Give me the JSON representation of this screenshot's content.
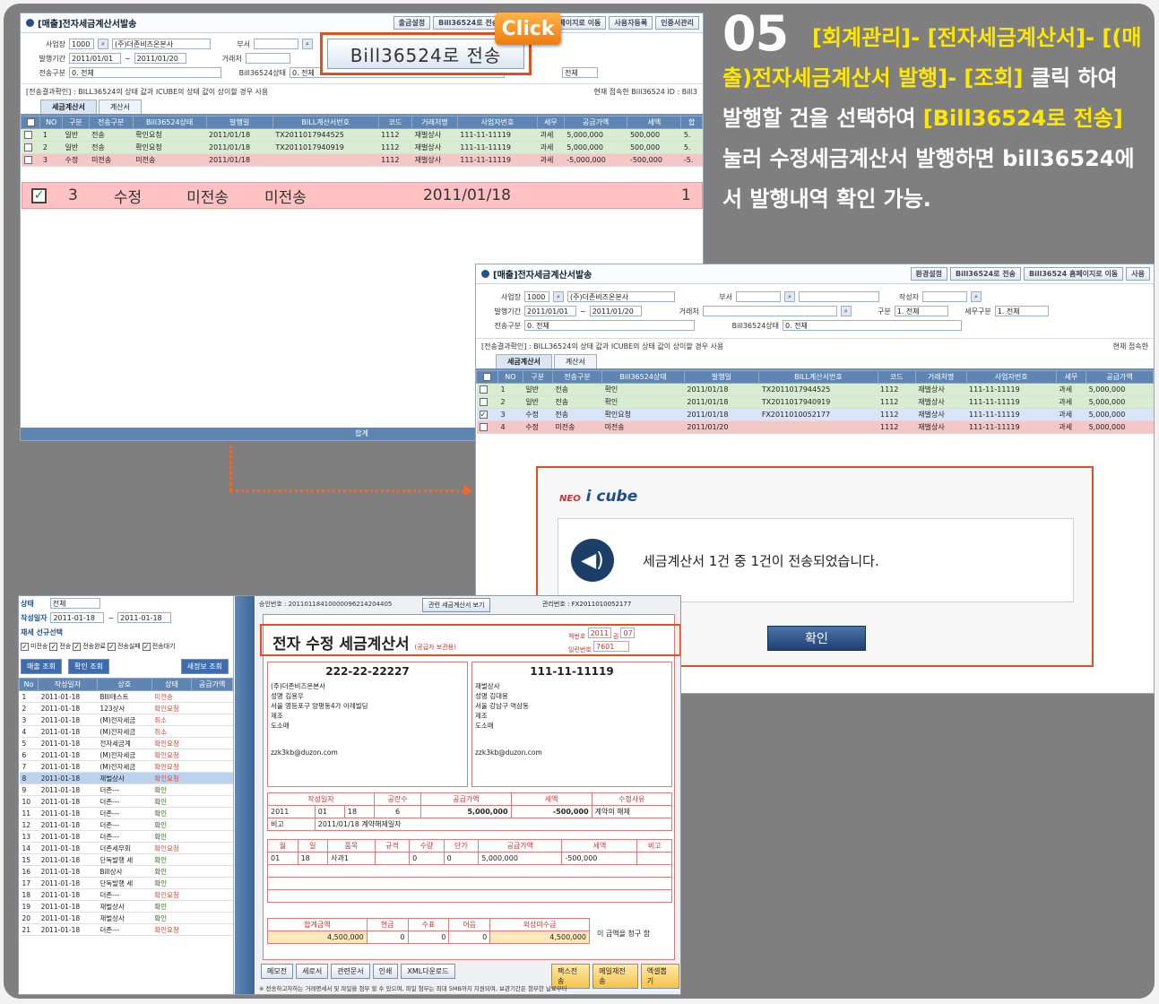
{
  "instruction": {
    "step": "05",
    "path": "[회계관리]- [전자세금계산서]- [(매출)전자세금계산서 발행]- [조회]",
    "middle": " 클릭 하여 발행할 건을 선택하여 ",
    "button_ref": "[Bill36524로 전송]",
    "tail": " 눌러 수정세금계산서 발행하면 bill36524에서 발행내역 확인 가능."
  },
  "callout": {
    "click": "Click",
    "send_button": "Bill36524로 전송"
  },
  "win1": {
    "title": "[매출]전자세금계산서발송",
    "buttons": [
      "출금설정",
      "Bill36524로 전송",
      "Bill36524 홈페이지로 이동",
      "사용자등록",
      "인증서관리"
    ],
    "form": {
      "biz_label": "사업장",
      "biz_code": "1000",
      "biz_name": "(주)더존비즈온본사",
      "dept_label": "부서",
      "period_label": "발행기간",
      "period_from": "2011/01/01",
      "period_to": "2011/01/20",
      "trade_label": "거래처",
      "send_label": "전송구분",
      "send_value": "0. 전체",
      "bill_label": "Bill36524상태",
      "bill_value": "0. 전체",
      "all": "전체"
    },
    "note": "[전송결과확인] : BILL36524의 상태 값과 ICUBE의 상태 값이 상이할 경우 사용",
    "note_right": "현재 접속한 Bill36524 ID : Bill3",
    "tabs": [
      "세금계산서",
      "계산서"
    ],
    "headers": [
      "",
      "NO",
      "구분",
      "전송구분",
      "Bill36524상태",
      "발행일",
      "BILL계산서번호",
      "코드",
      "거래처명",
      "사업자번호",
      "세무",
      "공급가액",
      "세액",
      "합"
    ],
    "rows": [
      [
        "",
        "1",
        "일반",
        "전송",
        "확인요청",
        "2011/01/18",
        "TX2011017944525",
        "1112",
        "재벌상사",
        "111-11-11119",
        "과세",
        "5,000,000",
        "500,000",
        "5."
      ],
      [
        "",
        "2",
        "일반",
        "전송",
        "확인요청",
        "2011/01/18",
        "TX2011017940919",
        "1112",
        "재벌상사",
        "111-11-11119",
        "과세",
        "5,000,000",
        "500,000",
        "5."
      ],
      [
        "",
        "3",
        "수정",
        "미전송",
        "미전송",
        "2011/01/18",
        "",
        "1112",
        "재벌상사",
        "111-11-11119",
        "과세",
        "-5,000,000",
        "-500,000",
        "-5."
      ]
    ],
    "big": {
      "no": "3",
      "type": "수정",
      "send": "미전송",
      "bill": "미전송",
      "date": "2011/01/18",
      "tail": "1"
    },
    "footer": "합계"
  },
  "win2": {
    "title": "[매출]전자세금계산서발송",
    "buttons": [
      "환경설정",
      "Bill36524로 전송",
      "Bill36524 홈페이지로 이동",
      "사용"
    ],
    "form": {
      "biz_label": "사업장",
      "biz_code": "1000",
      "biz_name": "(주)더존비즈온본사",
      "dept_label": "부서",
      "author_label": "작성자",
      "period_label": "발행기간",
      "period_from": "2011/01/01",
      "period_to": "2011/01/20",
      "trade_label": "거래처",
      "kind_label": "구분",
      "kind_value": "1. 전체",
      "tax_label": "세무구분",
      "tax_value": "1. 전체",
      "send_label": "전송구분",
      "send_value": "0. 전체",
      "bill_label": "Bill36524상태",
      "bill_value": "0. 전체"
    },
    "note": "[전송결과확인] : BILL36524의 상태 값과 ICUBE의 상태 값이 상이할 경우 사용",
    "note_right": "현재 접속한",
    "tabs": [
      "세금계산서",
      "계산서"
    ],
    "headers": [
      "",
      "NO",
      "구분",
      "전송구분",
      "Bill36524상태",
      "발행일",
      "BILL계산서번호",
      "코드",
      "거래처명",
      "사업자번호",
      "세무",
      "공급가액"
    ],
    "rows": [
      [
        "",
        "1",
        "일반",
        "전송",
        "확인",
        "2011/01/18",
        "TX2011017944525",
        "1112",
        "재벌상사",
        "111-11-11119",
        "과세",
        "5,000,000"
      ],
      [
        "",
        "2",
        "일반",
        "전송",
        "확인",
        "2011/01/18",
        "TX2011017940919",
        "1112",
        "재벌상사",
        "111-11-11119",
        "과세",
        "5,000,000"
      ],
      [
        "v",
        "3",
        "수정",
        "전송",
        "확인요청",
        "2011/01/18",
        "FX2011010052177",
        "1112",
        "재벌상사",
        "111-11-11119",
        "과세",
        "5,000,000"
      ],
      [
        "",
        "4",
        "수정",
        "미전송",
        "미전송",
        "2011/01/20",
        "",
        "1112",
        "재벌상사",
        "111-11-11119",
        "과세",
        "5,000,000"
      ]
    ]
  },
  "dialog": {
    "brand_a": "NEO",
    "brand_b": "i cube",
    "message": "세금계산서 1건 중 1건이 전송되었습니다.",
    "ok": "확인"
  },
  "win3": {
    "side_filter": {
      "status_label": "상태",
      "status_value": "전체",
      "date_label": "작성일자",
      "date_from": "2011-01-18",
      "date_to": "2011-01-18",
      "check_label": "재세 선규선택",
      "checks": [
        "미전송",
        "전송",
        "전송완료",
        "전송실패",
        "전송대기"
      ],
      "btn_a": "매출 조회",
      "btn_b": "확인 조회",
      "btn_c": "새정보 조회"
    },
    "side_headers": [
      "No",
      "작성일자",
      "상호",
      "상태",
      "공급가액"
    ],
    "side_rows": [
      [
        "1",
        "2011-01-18",
        "BIll테스트",
        "미전송"
      ],
      [
        "2",
        "2011-01-18",
        "123상사",
        "확인요청"
      ],
      [
        "3",
        "2011-01-18",
        "(M)전자세금",
        "취소"
      ],
      [
        "4",
        "2011-01-18",
        "(M)전자세금",
        "취소"
      ],
      [
        "5",
        "2011-01-18",
        "전자세금계",
        "확인요청"
      ],
      [
        "6",
        "2011-01-18",
        "(M)전자세금",
        "확인요청"
      ],
      [
        "7",
        "2011-01-18",
        "(M)전자세금",
        "확인요청"
      ],
      [
        "8",
        "2011-01-18",
        "재벌상사",
        "확인요청"
      ],
      [
        "9",
        "2011-01-18",
        "더존---",
        "확인"
      ],
      [
        "10",
        "2011-01-18",
        "더존---",
        "확인"
      ],
      [
        "11",
        "2011-01-18",
        "더존---",
        "확인"
      ],
      [
        "12",
        "2011-01-18",
        "더존---",
        "확인"
      ],
      [
        "13",
        "2011-01-18",
        "더존---",
        "확인"
      ],
      [
        "14",
        "2011-01-18",
        "더존세무회",
        "확인요청"
      ],
      [
        "15",
        "2011-01-18",
        "단독발행 세",
        "확인"
      ],
      [
        "16",
        "2011-01-18",
        "Bill상사",
        "확인"
      ],
      [
        "17",
        "2011-01-18",
        "단독발행 세",
        "확인"
      ],
      [
        "18",
        "2011-01-18",
        "더존---",
        "확인요청"
      ],
      [
        "19",
        "2011-01-18",
        "재벌상사",
        "확인"
      ],
      [
        "20",
        "2011-01-18",
        "재벌상사",
        "확인"
      ],
      [
        "21",
        "2011-01-18",
        "더존---",
        "확인요청"
      ]
    ],
    "top": {
      "approval": "승인번호 : 20110118410000096214204405",
      "orig_btn": "관련 세금계산서 보기",
      "mgmt": "관리번호 : FX2011010052177",
      "book_label": "책번호",
      "book_a": "2011",
      "book_b": "권",
      "book_c": "07",
      "serial_label": "일련번호",
      "serial": "7601"
    },
    "title": "전자 수정 세금계산서",
    "subtitle": "(공급자 보관용)",
    "supplier": {
      "regno": "222-22-22227",
      "name": "(주)더존비즈온본사",
      "ceo_label": "성명",
      "ceo": "김용우",
      "addr": "서울 영등포구 양평동4가 이레빌딩",
      "type": "제조",
      "item": "도소매",
      "email": "zzk3kb@duzon.com"
    },
    "buyer": {
      "regno": "111-11-11119",
      "name": "재벌상사",
      "ceo_label": "성명",
      "ceo": "김대용",
      "addr": "서울 강남구 역삼동",
      "type": "제조",
      "item": "도소매",
      "email": "zzk3kb@duzon.com"
    },
    "sums": {
      "h_date": "작성일자",
      "h_blank": "공란수",
      "h_supply": "공급가액",
      "h_tax": "세액",
      "h_reason": "수정사유",
      "y": "2011",
      "m": "01",
      "d": "18",
      "blank": "6",
      "supply": "5,000,000",
      "tax": "-500,000",
      "reason": "계약의 해제"
    },
    "remark_label": "비고",
    "remark": "2011/01/18 계약해제일자",
    "item_headers": [
      "월",
      "일",
      "품목",
      "규격",
      "수량",
      "단가",
      "공급가액",
      "세액",
      "비고"
    ],
    "item_row": [
      "01",
      "18",
      "사과1",
      "",
      "0",
      "0",
      "5,000,000",
      "-500,000",
      ""
    ],
    "totals_headers": [
      "합계금액",
      "현금",
      "수표",
      "어음",
      "외상미수금"
    ],
    "totals": [
      "4,500,000",
      "0",
      "0",
      "0",
      "4,500,000"
    ],
    "claim": "이 금액을 청구 함",
    "bottom_buttons": [
      "메모전",
      "세로서",
      "관련문서",
      "인쇄",
      "XML다운로드"
    ],
    "action_buttons": [
      "팩스전송",
      "메일재전송",
      "엑셀뽑기"
    ],
    "footnote": "※ 전송하고자하는 거래명세서 및 파일을 첨부 할 수 있으며, 파일 첨부는 최대 5MB까지 지원되며, 보관기간은 첨부한 날로부터"
  }
}
